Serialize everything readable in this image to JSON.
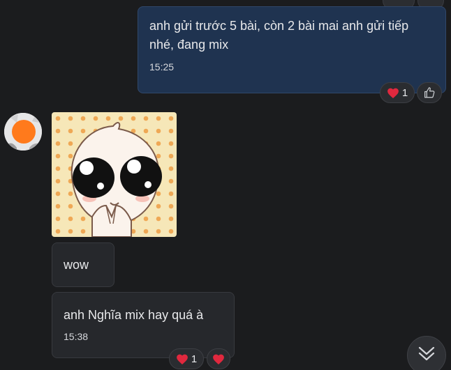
{
  "messages": [
    {
      "sender": "me",
      "text": "anh gửi trước 5 bài, còn 2 bài mai anh gửi tiếp nhé, đang mix",
      "time": "15:25",
      "reactions": [
        {
          "icon": "heart-icon",
          "count": "1"
        }
      ]
    },
    {
      "sender": "other",
      "sticker": "cute-pleading-character-sticker"
    },
    {
      "sender": "other",
      "text": "wow"
    },
    {
      "sender": "other",
      "text": "anh Nghĩa mix hay quá à",
      "time": "15:38",
      "reactions": [
        {
          "icon": "heart-icon",
          "count": "1"
        },
        {
          "icon": "heart-icon",
          "count": ""
        }
      ]
    }
  ],
  "actions": {
    "like_icon": "thumbs-up-icon",
    "scroll_down_icon": "double-chevron-down-icon"
  },
  "colors": {
    "background": "#1b1c1e",
    "my_bubble": "#1f3350",
    "their_bubble": "#26282c",
    "heart": "#e0283e"
  }
}
